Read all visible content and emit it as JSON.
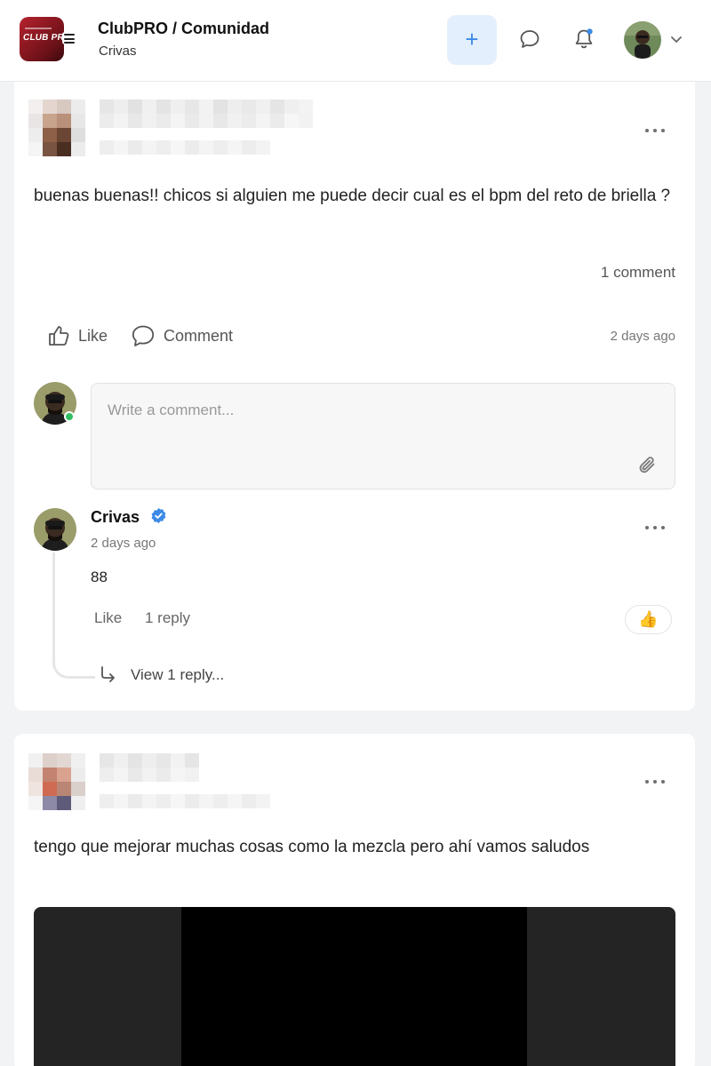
{
  "header": {
    "title": "ClubPRO / Comunidad",
    "subtitle": "Crivas",
    "logo_text": "CLUB PRO",
    "plus_label": "+",
    "accent": "#3d8ae6"
  },
  "icons": {
    "menu": "menu-icon",
    "chat": "chat-icon",
    "bell": "bell-icon",
    "caret": "chevron-down-icon",
    "like": "thumbs-up-icon",
    "comment": "comment-bubble-icon",
    "attach": "paperclip-icon",
    "verified": "verified-badge-icon",
    "reply": "reply-arrow-icon"
  },
  "post1": {
    "text": "buenas buenas!! chicos si alguien me puede decir cual es el bpm del reto de briella ?",
    "comment_count": "1 comment",
    "like_label": "Like",
    "comment_label": "Comment",
    "time": "2 days ago",
    "comment_placeholder": "Write a comment...",
    "comment": {
      "author": "Crivas",
      "time": "2 days ago",
      "text": "88",
      "like_label": "Like",
      "reply_count": "1 reply",
      "view_replies": "View 1 reply...",
      "reaction": "👍"
    }
  },
  "post2": {
    "text": "tengo que mejorar muchas cosas como la mezcla pero ahí vamos saludos"
  }
}
